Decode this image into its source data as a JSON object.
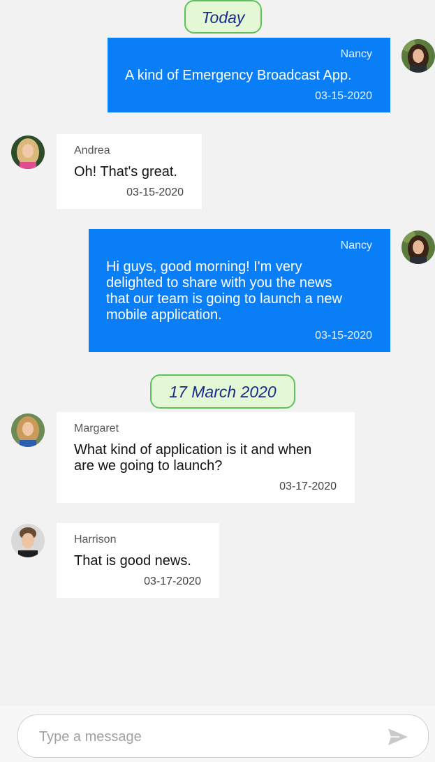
{
  "colors": {
    "outgoing": "#0a7ef6",
    "incoming": "#ffffff",
    "background": "#f2f2f2",
    "date_chip_bg": "#e4f8d6",
    "date_chip_border": "#5cc25a",
    "date_chip_text": "#1a2a8c"
  },
  "dates": [
    "Today",
    "17 March 2020"
  ],
  "messages": [
    {
      "sender": "Nancy",
      "lines": [
        "A kind of Emergency Broadcast App."
      ],
      "time": "03-15-2020",
      "direction": "outgoing"
    },
    {
      "sender": "Andrea",
      "lines": [
        "Oh! That's great."
      ],
      "time": "03-15-2020",
      "direction": "incoming"
    },
    {
      "sender": "Nancy",
      "lines": [
        "Hi guys, good morning! I'm very",
        "delighted to share with you the news",
        "that our team is going to launch a new",
        "mobile application."
      ],
      "time": "03-15-2020",
      "direction": "outgoing"
    },
    {
      "sender": "Margaret",
      "lines": [
        "What kind of application is it and when",
        "are we going to launch?"
      ],
      "time": "03-17-2020",
      "direction": "incoming"
    },
    {
      "sender": "Harrison",
      "lines": [
        "That is good news."
      ],
      "time": "03-17-2020",
      "direction": "incoming"
    }
  ],
  "composer": {
    "placeholder": "Type a message",
    "send_icon": "send-icon"
  }
}
